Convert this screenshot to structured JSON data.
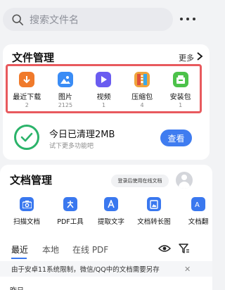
{
  "search": {
    "placeholder": "搜索文件名"
  },
  "file_management": {
    "title": "文件管理",
    "more_label": "更多",
    "categories": [
      {
        "label": "最近下载",
        "count": "2",
        "icon": "download-icon",
        "color": "#f07a2b"
      },
      {
        "label": "图片",
        "count": "2125",
        "icon": "image-icon",
        "color": "#3a8cf5"
      },
      {
        "label": "视频",
        "count": "1",
        "icon": "video-play-icon",
        "color": "#6a5cf0"
      },
      {
        "label": "压缩包",
        "count": "4",
        "icon": "archive-icon",
        "color": "#f0a43c"
      },
      {
        "label": "安装包",
        "count": "1",
        "icon": "package-icon",
        "color": "#4cc24a"
      }
    ]
  },
  "cleanup": {
    "title": "今日已清理2MB",
    "subtitle": "试下更多功能吧",
    "button_label": "查看"
  },
  "doc_management": {
    "title": "文档管理",
    "login_label": "登录后使用在线文档",
    "tools": [
      {
        "label": "扫描文档",
        "icon": "camera-icon"
      },
      {
        "label": "PDF工具",
        "icon": "pdf-icon"
      },
      {
        "label": "提取文字",
        "icon": "text-extract-icon"
      },
      {
        "label": "文档转长图",
        "icon": "long-image-icon"
      },
      {
        "label": "文档翻",
        "icon": "translate-icon"
      }
    ],
    "tabs": [
      "最近",
      "本地",
      "在线 PDF"
    ],
    "notice": "由于安卓11系统限制，微信/QQ中的文档需要另存",
    "bottom_label": "昨日"
  },
  "colors": {
    "accent": "#3a78ef",
    "highlight_border": "#e85a5e",
    "success": "#2bb36a"
  }
}
